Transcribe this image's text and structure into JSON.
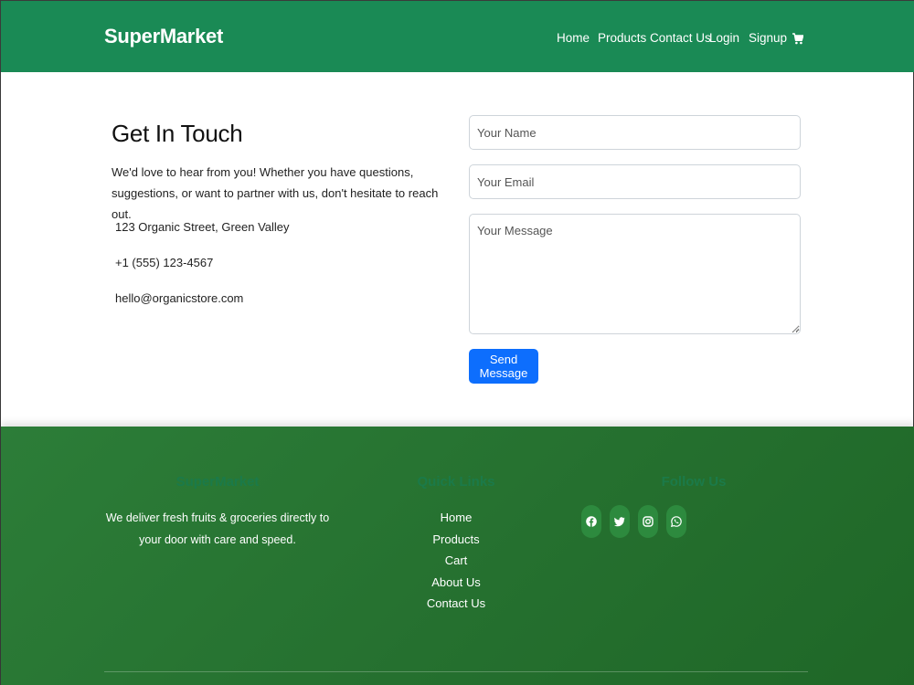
{
  "navbar": {
    "brand": "SuperMarket",
    "links": [
      "Home",
      "Products",
      "Contact Us",
      "Login",
      "Signup"
    ],
    "cart_icon": "cart-icon"
  },
  "contact": {
    "title": "Get In Touch",
    "description": "We'd love to hear from you! Whether you have questions, suggestions, or want to partner with us, don't hesitate to reach out.",
    "address": "123 Organic Street, Green Valley",
    "phone": "+1 (555) 123-4567",
    "email": "hello@organicstore.com"
  },
  "form": {
    "name_placeholder": "Your Name",
    "email_placeholder": "Your Email",
    "message_placeholder": "Your Message",
    "submit_label": "Send Message"
  },
  "footer": {
    "brand_heading": "SuperMarket",
    "about": "We deliver fresh fruits & groceries directly to your door with care and speed.",
    "quick_links_heading": "Quick Links",
    "quick_links": [
      "Home",
      "Products",
      "Cart",
      "About Us",
      "Contact Us"
    ],
    "follow_heading": "Follow Us",
    "social_icons": [
      "facebook-icon",
      "twitter-icon",
      "instagram-icon",
      "whatsapp-icon"
    ]
  },
  "colors": {
    "navbar": "#1a8a55",
    "footer": "#2c7d38",
    "button": "#0d6efd",
    "footer_heading": "#1b7a49"
  }
}
